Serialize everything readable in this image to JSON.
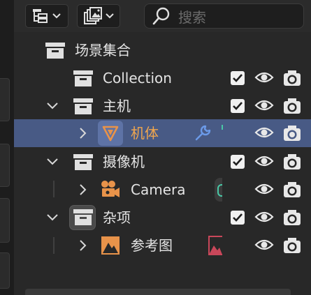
{
  "header": {
    "search_placeholder": "搜索"
  },
  "tree": {
    "scene": "场景集合",
    "collection": "Collection",
    "main": "主机",
    "body": "机体",
    "camera_col": "摄像机",
    "camera": "Camera",
    "misc": "杂项",
    "ref": "参考图"
  },
  "colors": {
    "selected_row": "#485a85",
    "active_text": "#f0a64e",
    "mesh_icon": "#e8934a",
    "modifier_icon": "#6b9ae8",
    "camera_data_icon": "#49c8a6",
    "image_data_icon": "#c9475a"
  }
}
